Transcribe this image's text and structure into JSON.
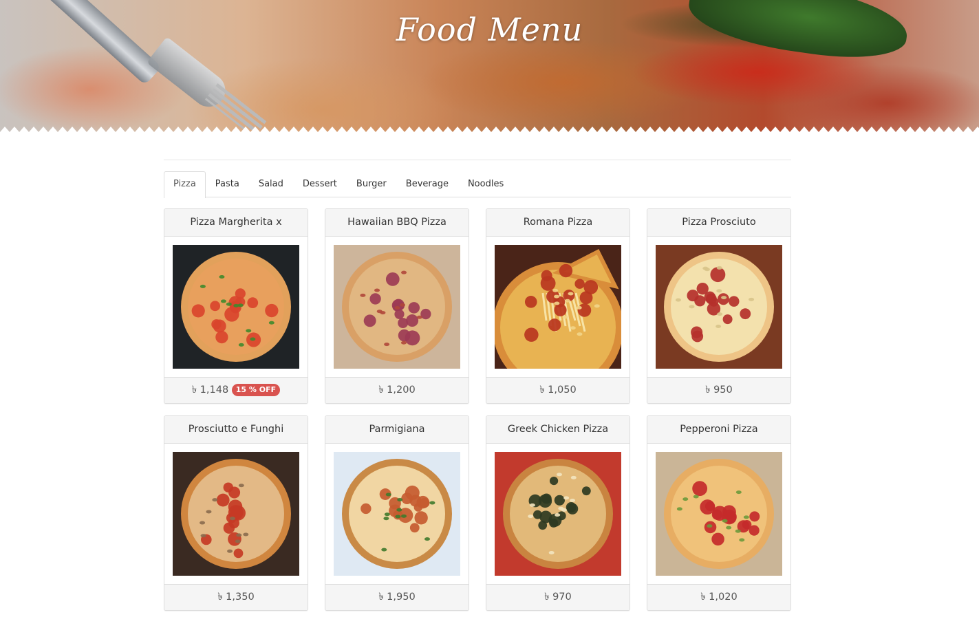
{
  "header": {
    "title": "Food Menu"
  },
  "tabs": [
    {
      "label": "Pizza",
      "active": true
    },
    {
      "label": "Pasta",
      "active": false
    },
    {
      "label": "Salad",
      "active": false
    },
    {
      "label": "Dessert",
      "active": false
    },
    {
      "label": "Burger",
      "active": false
    },
    {
      "label": "Beverage",
      "active": false
    },
    {
      "label": "Noodles",
      "active": false
    }
  ],
  "items": [
    {
      "name": "Pizza Margherita x",
      "price": "৳ 1,148",
      "badge": "15 % OFF",
      "image": "pizza-margherita-photo"
    },
    {
      "name": "Hawaiian BBQ Pizza",
      "price": "৳ 1,200",
      "image": "hawaiian-bbq-pizza-photo"
    },
    {
      "name": "Romana Pizza",
      "price": "৳ 1,050",
      "image": "romana-pizza-photo"
    },
    {
      "name": "Pizza Prosciuto",
      "price": "৳ 950",
      "image": "pizza-prosciuto-photo"
    },
    {
      "name": "Prosciutto e Funghi",
      "price": "৳ 1,350",
      "image": "prosciutto-funghi-photo"
    },
    {
      "name": "Parmigiana",
      "price": "৳ 1,950",
      "image": "parmigiana-photo"
    },
    {
      "name": "Greek Chicken Pizza",
      "price": "৳ 970",
      "image": "greek-chicken-pizza-photo"
    },
    {
      "name": "Pepperoni Pizza",
      "price": "৳ 1,020",
      "image": "pepperoni-pizza-photo"
    }
  ],
  "colors": {
    "badge": "#d9534f",
    "panel_header": "#f5f5f5",
    "border": "#dddddd"
  }
}
